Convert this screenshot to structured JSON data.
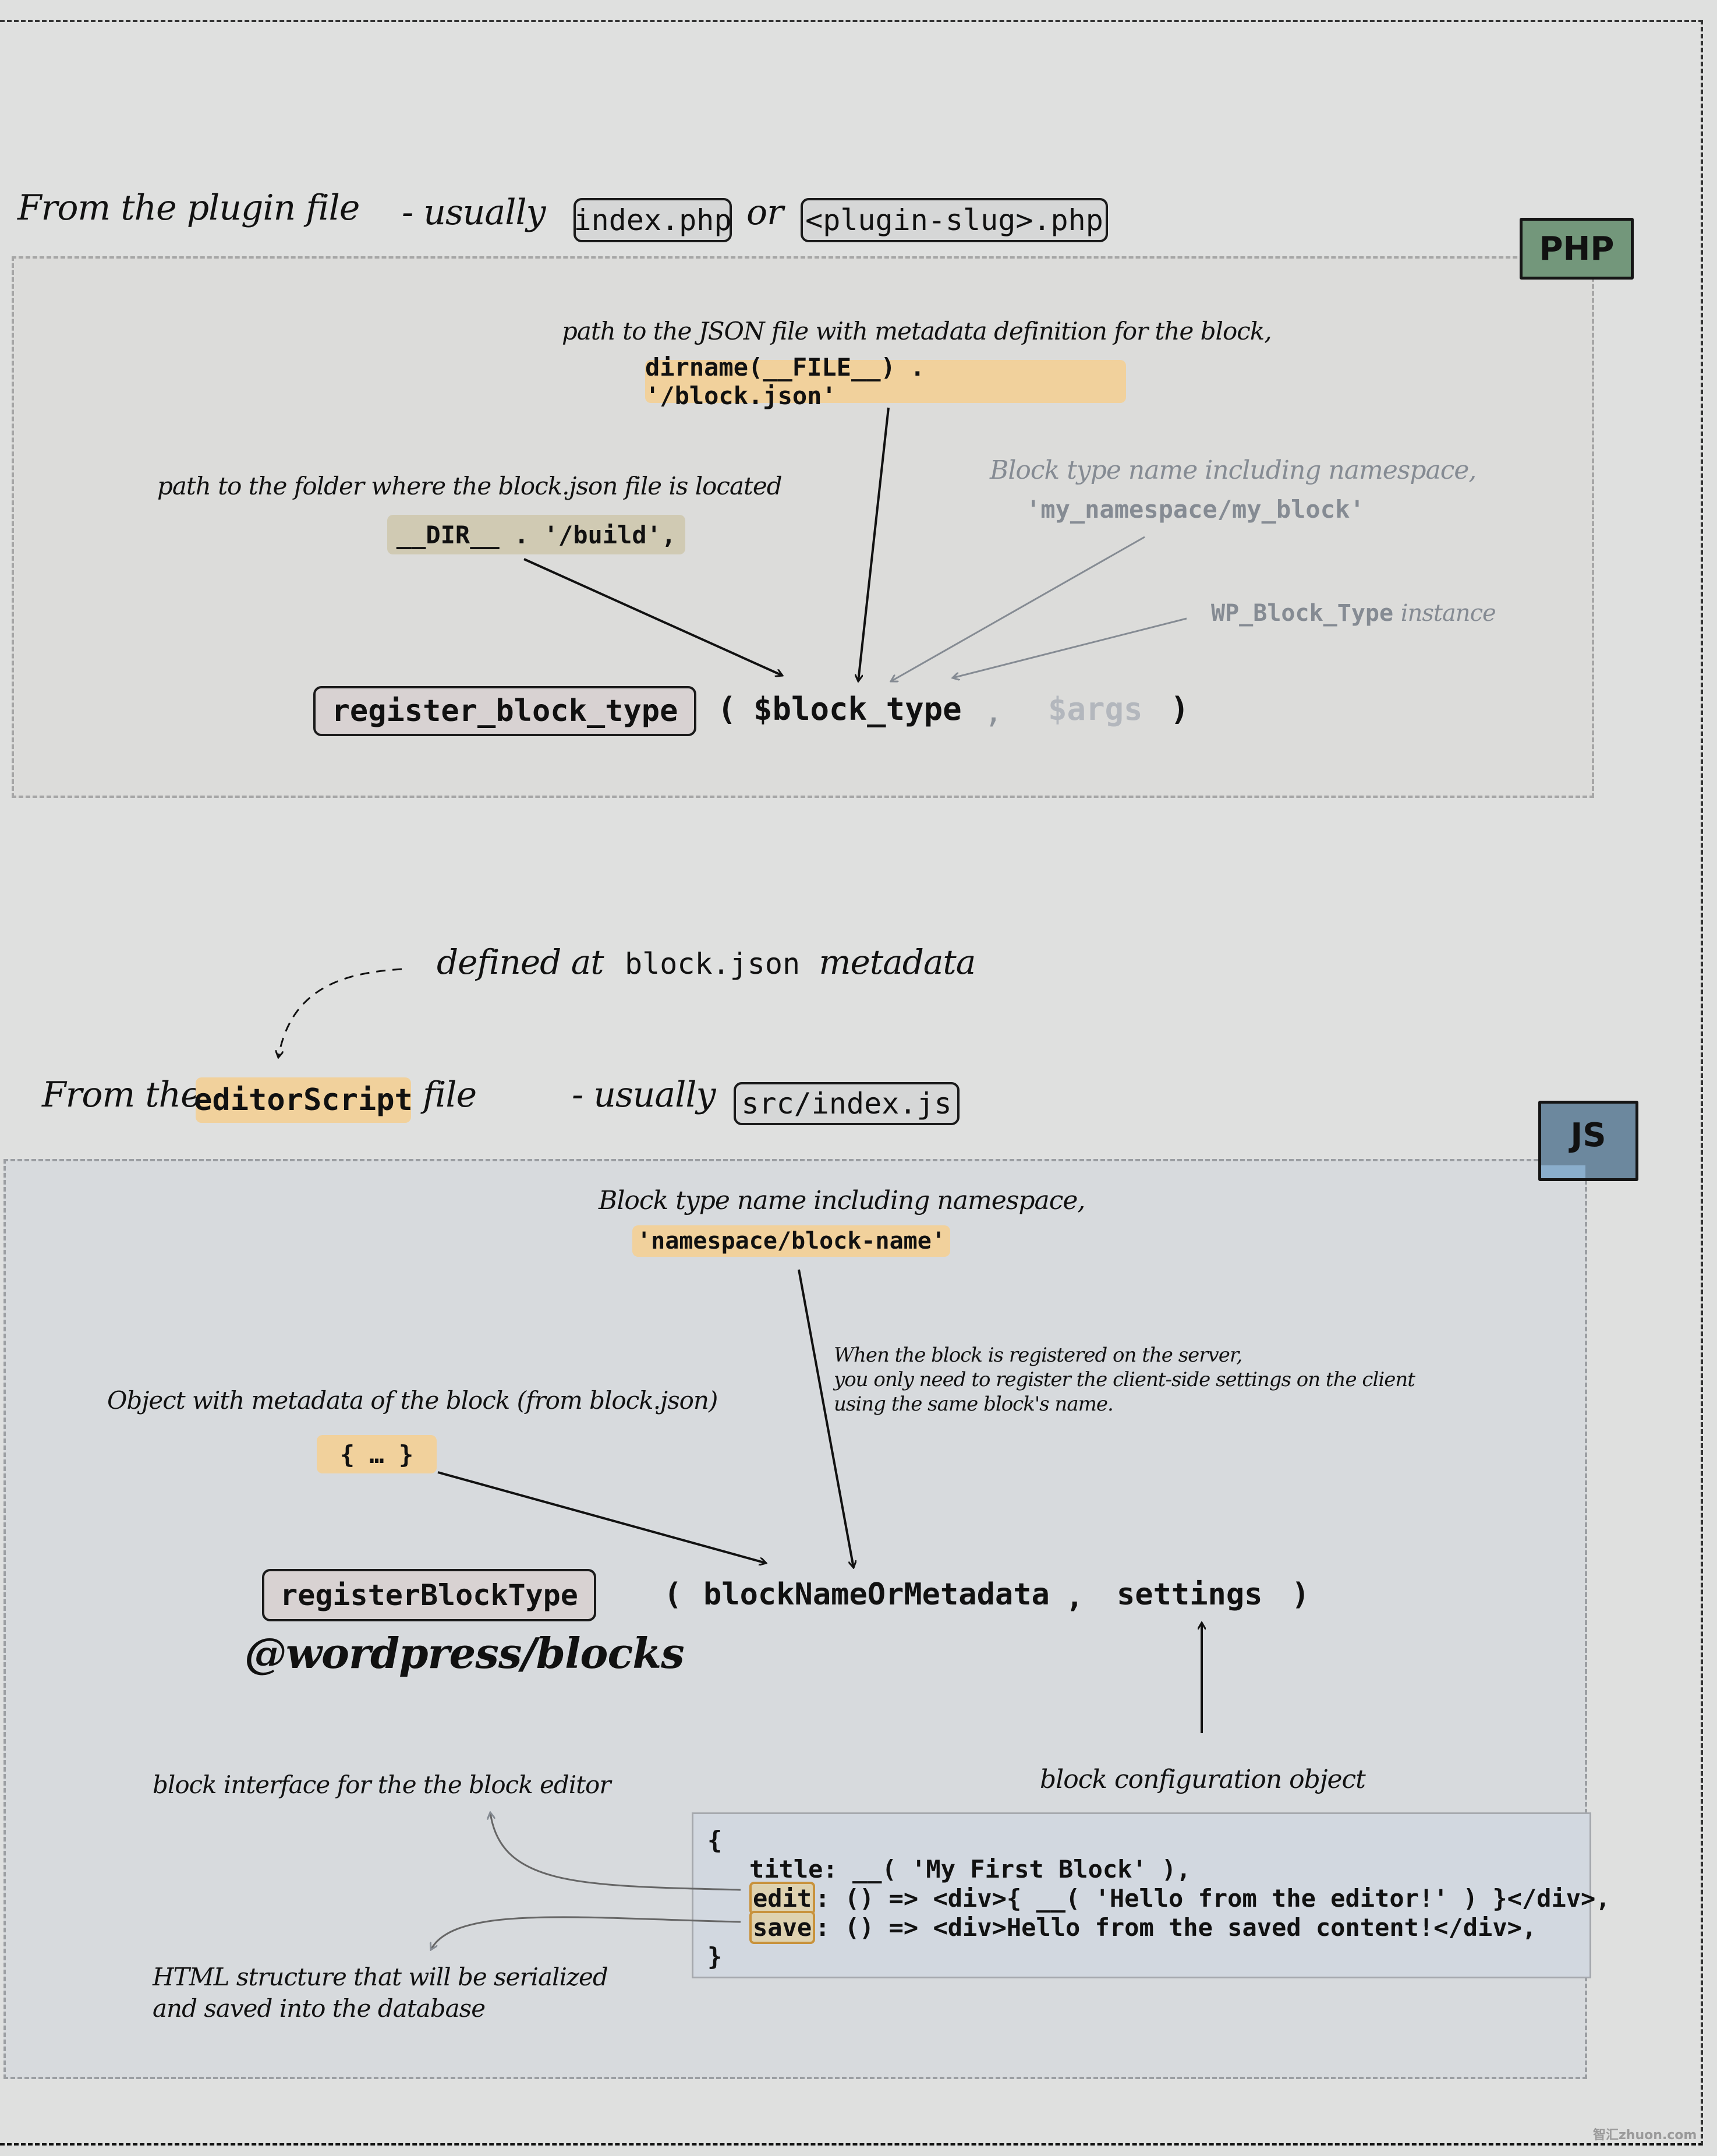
{
  "php_section": {
    "heading": "From the plugin file",
    "usually_label": "- usually",
    "file_option_1": "index.php",
    "or_label": "or",
    "file_option_2": "<plugin-slug>.php",
    "tag": "PHP",
    "json_path_note": "path to the JSON file with metadata definition for the block,",
    "json_path_code": "dirname(__FILE__) . '/block.json'",
    "folder_path_note": "path to the folder where the block.json file is located",
    "folder_path_code": "__DIR__ . '/build',",
    "block_name_note": "Block type name including namespace,",
    "block_name_code": "'my_namespace/my_block'",
    "instance_code": "WP_Block_Type",
    "instance_note": "instance",
    "function_name": "register_block_type",
    "open_paren": "(",
    "arg_1": "$block_type",
    "comma": ",",
    "arg_2": "$args",
    "close_paren": ")"
  },
  "middle": {
    "defined_at": "defined at",
    "defined_code": "block.json",
    "defined_suffix": "metadata"
  },
  "js_section": {
    "heading_prefix": "From the",
    "heading_code": "editorScript",
    "heading_suffix": "file",
    "usually_label": "- usually",
    "file_option": "src/index.js",
    "tag": "JS",
    "block_name_note": "Block type name including namespace,",
    "block_name_code": "'namespace/block-name'",
    "server_note": [
      "When the block is registered on the server,",
      "you only need to register the client-side settings on the client",
      "using the same block's name."
    ],
    "metadata_note": "Object with metadata of the block (from block.json)",
    "metadata_code": "{ … }",
    "function_name": "registerBlockType",
    "package_name": "@wordpress/blocks",
    "open_paren": "(",
    "arg_1": "blockNameOrMetadata",
    "comma": ",",
    "arg_2": "settings",
    "close_paren": ")",
    "config_note": "block configuration object",
    "edit_note": "block interface for the the block editor",
    "save_note": [
      "HTML structure that will be serialized",
      "and saved into the database"
    ],
    "config_code": {
      "open": "{",
      "title_line": "  title: __( 'My First Block' ),",
      "edit_key": "edit",
      "edit_rest": ": () => <div>{ __( 'Hello from the editor!' ) }</div>,",
      "save_key": "save",
      "save_rest": ": () => <div>Hello from the saved content!</div>,",
      "close": "}"
    }
  },
  "watermark": "智汇zhuon.com",
  "colors": {
    "background": "#dfe0df",
    "php_tag": "#73977b",
    "js_tag": "#6c889e",
    "highlight_orange": "#f1d19c",
    "highlight_khaki": "#d0cab3",
    "function_box": "#d8d2d2",
    "muted_gray": "#858b93"
  }
}
